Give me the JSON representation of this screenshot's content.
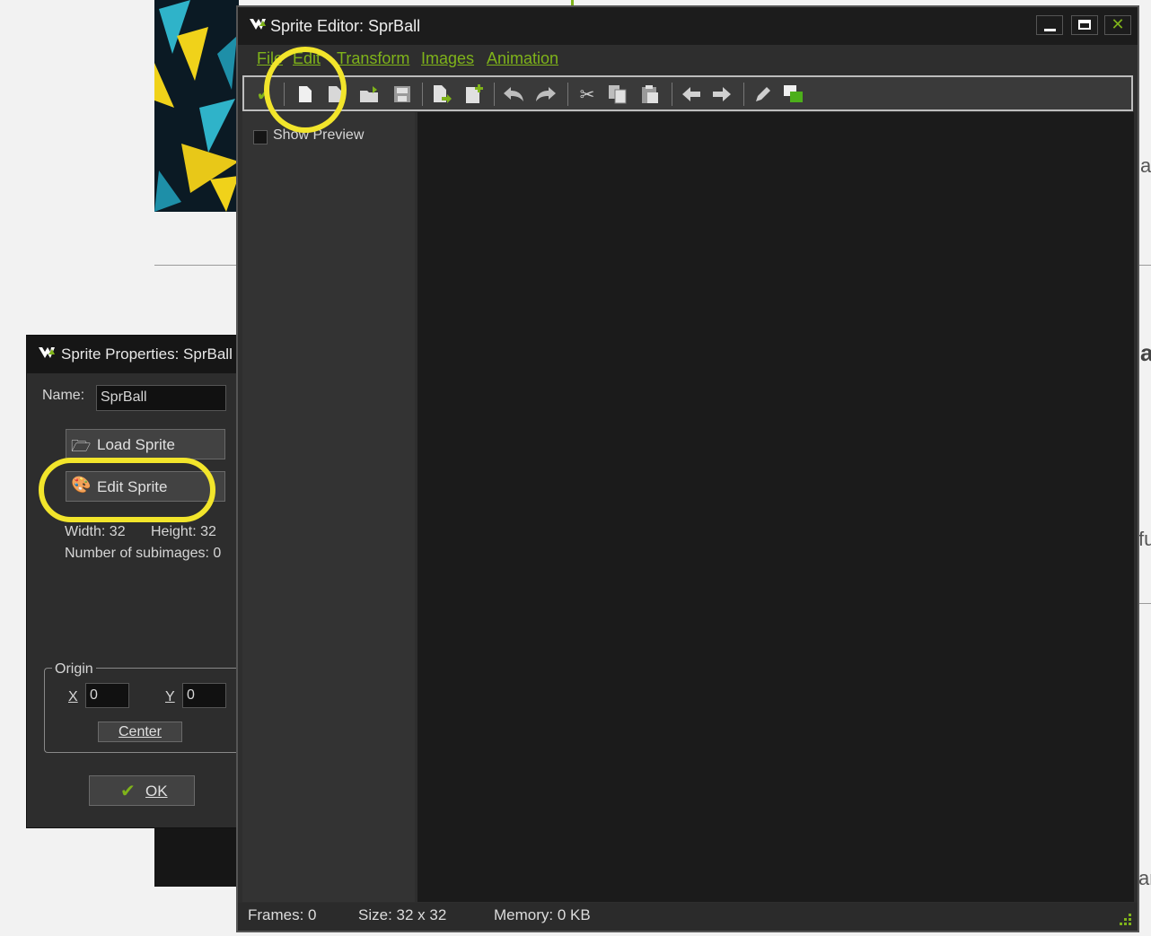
{
  "background_page": {
    "fragments": [
      "a",
      "a",
      "fu",
      "ar"
    ]
  },
  "properties_window": {
    "title": "Sprite Properties: SprBall",
    "name_label": "Name:",
    "name_value": "SprBall",
    "load_sprite_label": "Load Sprite",
    "edit_sprite_label": "Edit Sprite",
    "width_text": "Width: 32",
    "height_text": "Height: 32",
    "subimages_text": "Number of subimages: 0",
    "origin_label": "Origin",
    "x_label": "X",
    "x_value": "0",
    "y_label": "Y",
    "y_value": "0",
    "center_label": "Center",
    "ok_label": "OK"
  },
  "editor_window": {
    "title": "Sprite Editor: SprBall",
    "menu": [
      "File",
      "Edit",
      "Transform",
      "Images",
      "Animation"
    ],
    "toolbar_icons": [
      "confirm-check-icon",
      "new-sprite-icon",
      "create-from-file-icon",
      "open-file-icon",
      "save-icon",
      "add-from-file-icon",
      "add-blank-icon",
      "undo-icon",
      "redo-icon",
      "cut-icon",
      "copy-icon",
      "paste-icon",
      "shift-left-icon",
      "shift-right-icon",
      "edit-image-icon",
      "colors-icon"
    ],
    "show_preview_label": "Show Preview",
    "status": {
      "frames": "Frames: 0",
      "size": "Size: 32 x 32",
      "memory": "Memory: 0 KB"
    }
  },
  "colors": {
    "accent_green": "#7fb31a",
    "highlight_yellow": "#f2e52b",
    "window_dark": "#1c1c1c"
  }
}
